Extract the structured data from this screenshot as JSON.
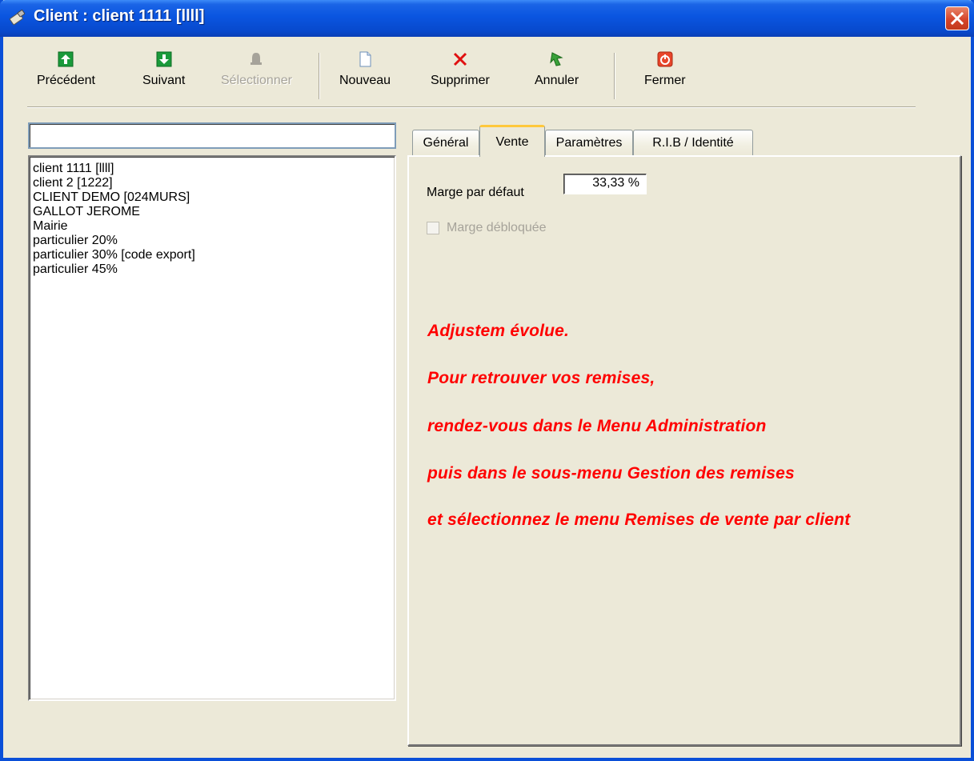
{
  "window": {
    "title": "Client : client 1111 [llll]"
  },
  "toolbar": {
    "prev_label": "Précédent",
    "next_label": "Suivant",
    "select_label": "Sélectionner",
    "new_label": "Nouveau",
    "delete_label": "Supprimer",
    "cancel_label": "Annuler",
    "close_label": "Fermer"
  },
  "search": {
    "value": ""
  },
  "clients": [
    "client 1111 [llll]",
    "client 2 [1222]",
    "CLIENT DEMO [024MURS]",
    "GALLOT JEROME",
    "Mairie",
    "particulier 20%",
    "particulier 30% [code export]",
    "particulier 45%"
  ],
  "tabs": [
    {
      "label": "Général"
    },
    {
      "label": "Vente"
    },
    {
      "label": "Paramètres"
    },
    {
      "label": "R.I.B / Identité"
    }
  ],
  "active_tab": "Vente",
  "vente": {
    "marge_label": "Marge par défaut",
    "marge_value": "33,33 %",
    "marge_debloquee_label": "Marge débloquée",
    "marge_debloquee_checked": false,
    "notice_lines": [
      "Adjustem évolue.",
      "Pour retrouver vos remises,",
      "rendez-vous dans le Menu Administration",
      "puis dans le sous-menu Gestion des remises",
      "et sélectionnez le menu Remises de vente par client"
    ]
  },
  "colors": {
    "titlebar": "#0a55e0",
    "notice_text": "#ff0000",
    "window_bg": "#ece9d8"
  }
}
